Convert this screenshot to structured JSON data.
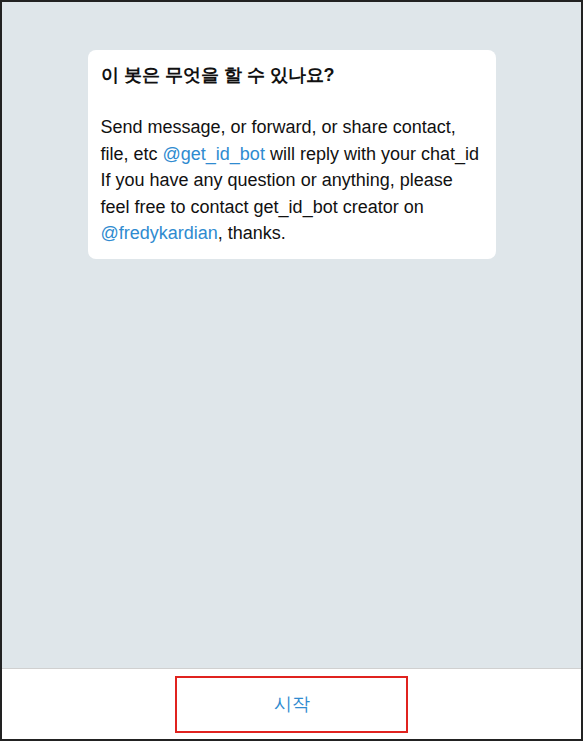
{
  "info_card": {
    "title": "이 봇은 무엇을 할 수 있나요?",
    "paragraphs": [
      {
        "segments": [
          {
            "kind": "text",
            "text": "Send message, or forward, or share contact, file, etc "
          },
          {
            "kind": "link",
            "text": "@get_id_bot"
          },
          {
            "kind": "text",
            "text": " will reply with your chat_id"
          }
        ]
      },
      {
        "segments": [
          {
            "kind": "text",
            "text": "If you have any question or anything, please feel free to contact get_id_bot creator on "
          },
          {
            "kind": "link",
            "text": "@fredykardian"
          },
          {
            "kind": "text",
            "text": ", thanks."
          }
        ]
      }
    ]
  },
  "start_button": {
    "label": "시작",
    "highlighted": true
  }
}
